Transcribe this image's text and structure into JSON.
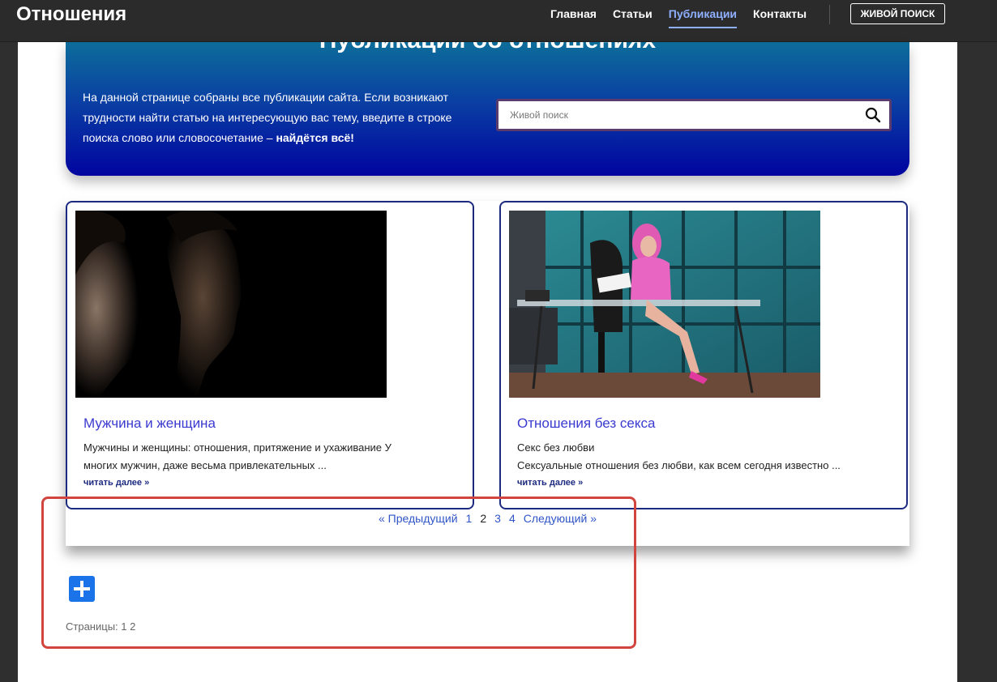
{
  "header": {
    "brand": "Отношения",
    "nav": [
      {
        "label": "Главная"
      },
      {
        "label": "Статьи"
      },
      {
        "label": "Публикации",
        "active": true
      },
      {
        "label": "Контакты"
      }
    ],
    "live_search_button": "ЖИВОЙ ПОИСК"
  },
  "hero": {
    "title": "Публикации об отношениях",
    "text_main": "На данной странице собраны все публикации сайта. Если возникают трудности найти статью на интересующую вас тему, введите в строке поиска слово или словосочетание – ",
    "text_bold": "найдётся всё!",
    "search_placeholder": "Живой поиск"
  },
  "cards": [
    {
      "title": "Мужчина и женщина",
      "excerpt_line1": "Мужчины и женщины: отношения, притяжение и ухаживание У",
      "excerpt_line2": "многих мужчин, даже весьма привлекательных ...",
      "more": "читать далее »",
      "image": "couple-profile-dark-photo"
    },
    {
      "title": "Отношения без секса",
      "excerpt_line1": "Секс без любви",
      "excerpt_line2": "Сексуальные отношения без любви, как всем сегодня известно ...",
      "more": "читать далее »",
      "image": "office-woman-pink-hair-photo"
    }
  ],
  "pagination": {
    "prev": "« Предыдущий",
    "pages": [
      "1",
      "2",
      "3",
      "4"
    ],
    "current": "2",
    "next": "Следующий »"
  },
  "footer": {
    "plus_icon": "plus-icon",
    "pages_note": "Страницы: 1 2"
  },
  "colors": {
    "accent": "#8fb0ff",
    "highlight": "#d2453f",
    "card_border": "#1c2b80",
    "link": "#2f55c7"
  }
}
